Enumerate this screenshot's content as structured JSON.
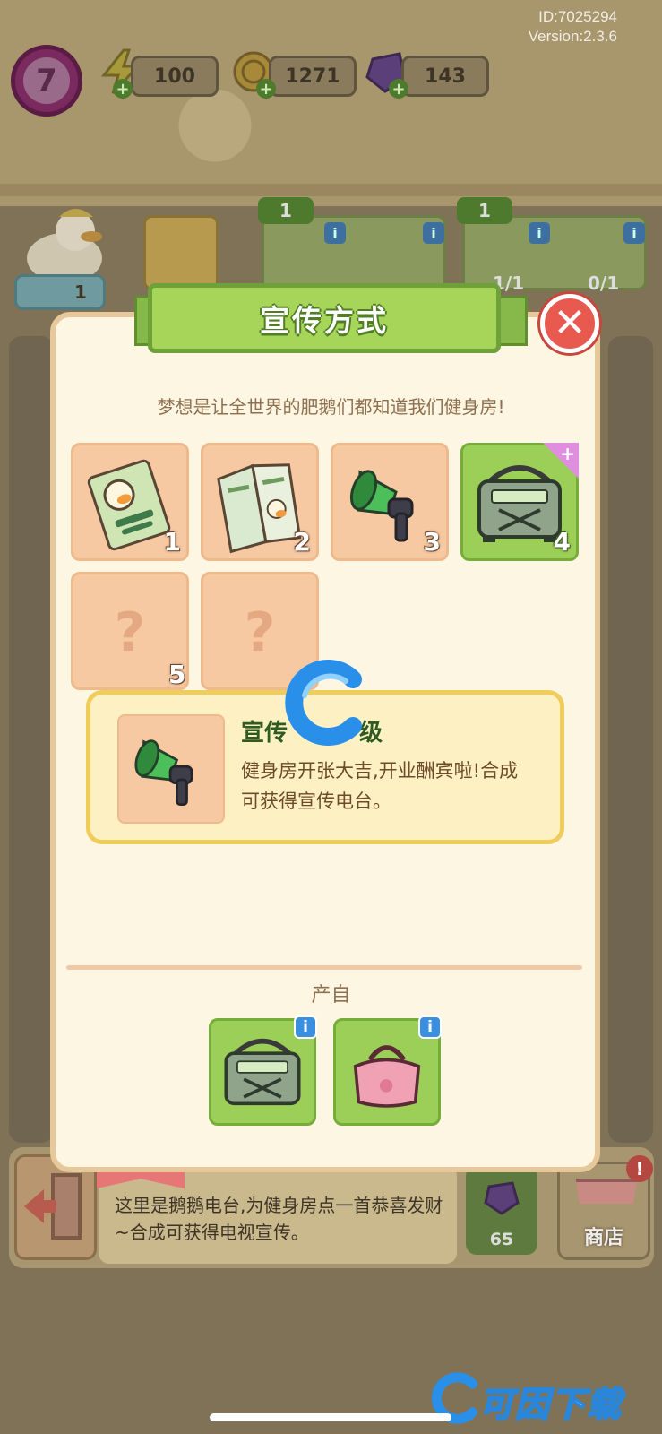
{
  "hud": {
    "level": "7",
    "energy": "100",
    "coins": "1271",
    "gems": "143",
    "id_text": "ID:7025294",
    "version_text": "Version:2.3.6"
  },
  "background": {
    "goose_badge": "1",
    "slot1_badge": "1",
    "slot2_badge": "1",
    "slot2_progress": "1/1",
    "slot3_progress": "0/1"
  },
  "modal": {
    "title": "宣传方式",
    "close_icon": "close-icon",
    "subtitle": "梦想是让全世界的肥鹅们都知道我们健身房!",
    "tiles": [
      {
        "num": "1",
        "icon": "gym-flyer-icon",
        "state": "unlocked"
      },
      {
        "num": "2",
        "icon": "brochure-icon",
        "state": "unlocked"
      },
      {
        "num": "3",
        "icon": "megaphone-icon",
        "state": "unlocked"
      },
      {
        "num": "4",
        "icon": "radio-icon",
        "state": "active"
      },
      {
        "num": "",
        "icon": "question-icon",
        "state": "locked",
        "mark": "?"
      },
      {
        "num": "5",
        "icon": "question-icon",
        "state": "locked",
        "mark": "?"
      }
    ],
    "detail": {
      "title_left": "宣传",
      "title_right": "级",
      "description": "健身房开张大吉,开业酬宾啦!合成可获得宣传电台。",
      "icon": "megaphone-icon"
    },
    "produce_label": "产自",
    "produce_items": [
      {
        "icon": "radio-icon",
        "info": "i"
      },
      {
        "icon": "pink-bag-icon",
        "info": "i"
      }
    ]
  },
  "bottom": {
    "description": "这里是鹅鹅电台,为健身房点一首恭喜发财~合成可获得电视宣传。",
    "gem_cost": "65",
    "shop_label": "商店",
    "shop_alert": "!"
  },
  "watermark": {
    "brand_text": "可因下载"
  },
  "colors": {
    "ribbon_green": "#a7d55a",
    "tile_peach": "#f6c9a3",
    "tile_active_green": "#9ccf57",
    "close_red": "#e8594f",
    "detail_yellow": "#fdf1c4",
    "info_blue": "#3a8fe0"
  }
}
